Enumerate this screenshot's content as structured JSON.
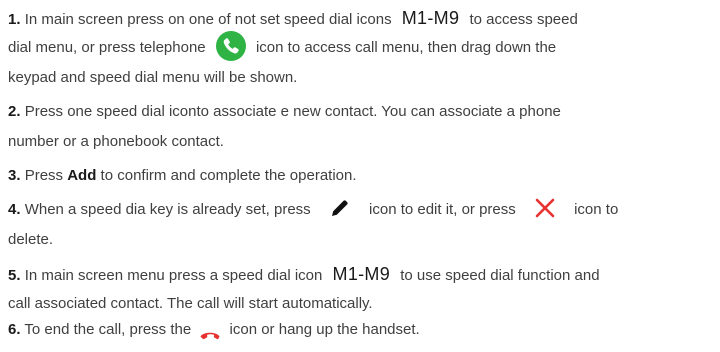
{
  "steps": [
    {
      "number": "1.",
      "t1": "In main screen press on one of not set speed dial icons",
      "code": "M1-M9",
      "t2": "to access speed",
      "t3": "dial menu, or press telephone",
      "t4": "icon to access call menu, then drag down the",
      "t5": "keypad and speed dial menu will be shown."
    },
    {
      "number": "2.",
      "t1": "Press one speed dial iconto associate e new contact. You can associate a phone",
      "t2": "number or a phonebook contact."
    },
    {
      "number": "3.",
      "t1": "Press",
      "bold": "Add",
      "t2": "to confirm and complete the operation."
    },
    {
      "number": "4.",
      "t1": "When a speed dia key is already set, press",
      "t2": "icon to edit it, or press",
      "t3": "icon to",
      "t4": "delete."
    },
    {
      "number": "5.",
      "t1": "In main screen menu press a speed dial icon",
      "code": "M1-M9",
      "t2": "to use speed dial function and",
      "t3": "call associated contact. The call will start automatically."
    },
    {
      "number": "6.",
      "t1": "To end the call, press the",
      "t2": "icon or hang up the handset."
    }
  ],
  "icons": {
    "phone": "phone-icon",
    "edit": "pencil-icon",
    "delete": "x-icon",
    "end_call": "handset-down-icon"
  },
  "colors": {
    "phone_green": "#2fb344",
    "delete_red": "#e8312f",
    "end_call_red": "#e8312f"
  }
}
